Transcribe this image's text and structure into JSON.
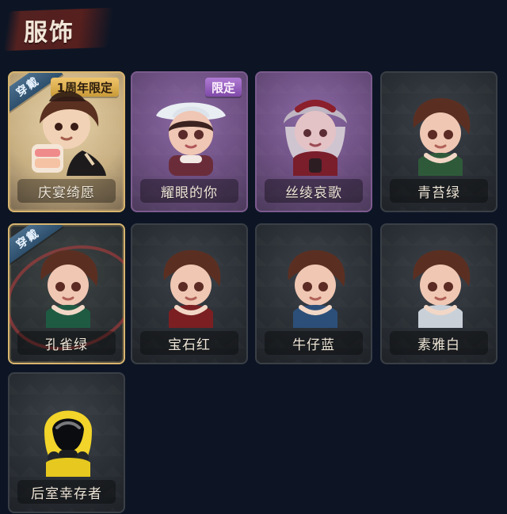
{
  "header": {
    "title": "服饰"
  },
  "cards": [
    {
      "label": "庆宴绮愿",
      "badge": "1周年限定",
      "worn_tag": "穿戴",
      "theme": "gold"
    },
    {
      "label": "耀眼的你",
      "badge": "限定",
      "theme": "purple"
    },
    {
      "label": "丝绫哀歌",
      "theme": "purple"
    },
    {
      "label": "青苔绿",
      "theme": "gray"
    },
    {
      "label": "孔雀绿",
      "worn_tag": "穿戴",
      "theme": "gold-dark"
    },
    {
      "label": "宝石红",
      "theme": "gray"
    },
    {
      "label": "牛仔蓝",
      "theme": "gray"
    },
    {
      "label": "素雅白",
      "theme": "gray"
    },
    {
      "label": "后室幸存者",
      "theme": "gray"
    }
  ],
  "colors": {
    "background": "#0d1524",
    "label_text": "#efe6d8",
    "gold": "#d8b56f",
    "purple": "#7b5b8e",
    "worn_tag_bg": "#2d4f6c",
    "limited_badge_gold": "#c99b38",
    "limited_badge_purple": "#7f4aa8"
  },
  "icons": {
    "portrait_icon": "character-portrait-icon",
    "worn_tag_icon": "equipped-tag-icon",
    "limited_badge_icon": "limited-badge-icon"
  }
}
